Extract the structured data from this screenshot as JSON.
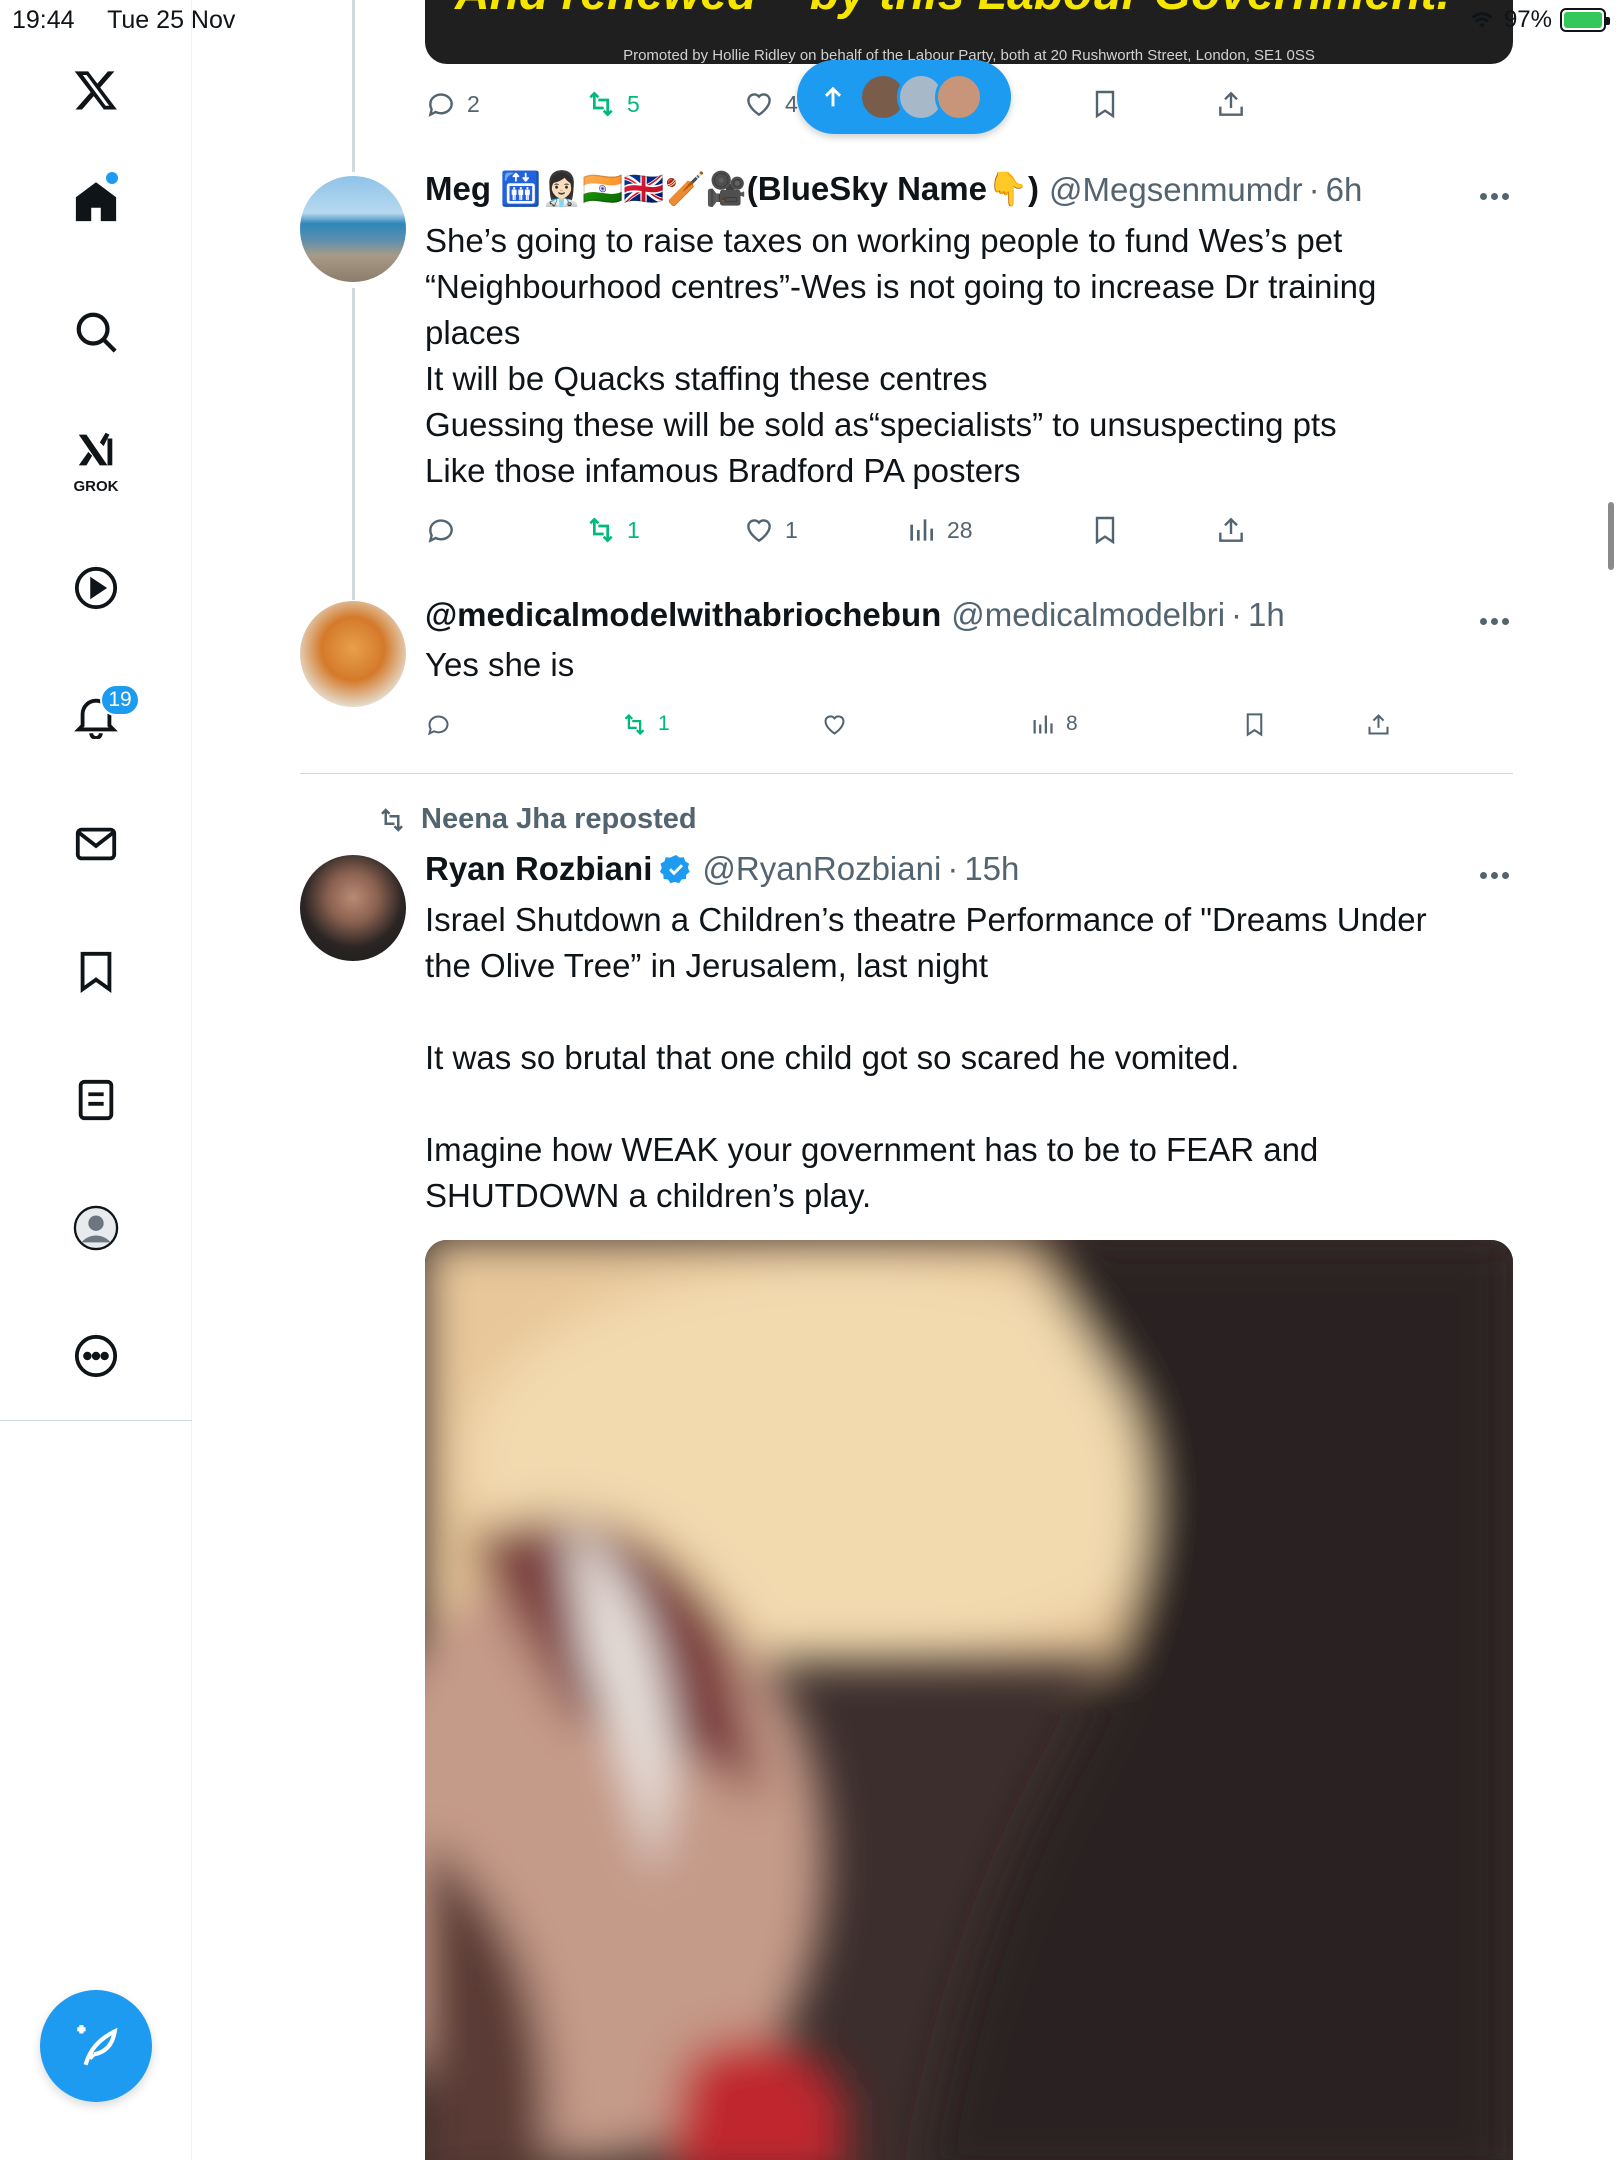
{
  "status_bar": {
    "time": "19:44",
    "date": "Tue 25 Nov",
    "battery": "97%",
    "icons": [
      "wifi-icon",
      "battery-charging-icon"
    ]
  },
  "sidebar": {
    "items": [
      {
        "name": "x-logo",
        "icon": "x-logo-icon"
      },
      {
        "name": "home",
        "icon": "home-icon"
      },
      {
        "name": "explore",
        "icon": "search-icon"
      },
      {
        "name": "grok",
        "icon": "grok-icon",
        "label": "GROK"
      },
      {
        "name": "video",
        "icon": "play-icon"
      },
      {
        "name": "notifications",
        "icon": "bell-icon",
        "badge": "19"
      },
      {
        "name": "messages",
        "icon": "mail-icon"
      },
      {
        "name": "bookmarks",
        "icon": "bookmark-icon"
      },
      {
        "name": "lists",
        "icon": "list-icon"
      },
      {
        "name": "profile",
        "icon": "profile-icon"
      },
      {
        "name": "more",
        "icon": "more-circle-icon"
      }
    ],
    "compose_icon": "compose-feather-icon"
  },
  "ad": {
    "headline": "And renewed – by this Labour Government.",
    "promo": "Promoted by Hollie Ridley on behalf of the Labour Party, both at 20 Rushworth Street, London, SE1 0SS",
    "actions": {
      "replies": "2",
      "reposts": "5",
      "likes": "4"
    }
  },
  "new_posts_pill": {
    "icon": "arrow-up-icon"
  },
  "tweets": [
    {
      "name": "Meg 🛗👩🏻‍⚕️🇮🇳🇬🇧🏏🎥(BlueSky Name👇)",
      "handle": "@Megsenmumdr",
      "time": "6h",
      "lines": [
        "She’s going to raise taxes on working people to fund Wes’s pet",
        "“Neighbourhood centres”-Wes is not going to increase Dr training",
        "places",
        "It will be Quacks staffing these centres",
        "Guessing these will be sold as“specialists” to unsuspecting pts",
        "Like those infamous Bradford PA posters"
      ],
      "actions": {
        "replies": "",
        "reposts": "1",
        "likes": "1",
        "views": "28"
      }
    },
    {
      "name": "@medicalmodelwithabriochebun",
      "handle": "@medicalmodelbri",
      "time": "1h",
      "lines": [
        "Yes she is"
      ],
      "actions": {
        "replies": "",
        "reposts": "1",
        "likes": "",
        "views": "8"
      }
    },
    {
      "reposted_by": "Neena Jha reposted",
      "name": "Ryan Rozbiani",
      "handle": "@RyanRozbiani",
      "time": "15h",
      "verified": true,
      "lines": [
        "Israel Shutdown a Children’s theatre Performance of \"Dreams Under",
        "the Olive Tree” in Jerusalem, last night",
        "",
        "It was so brutal that one child got so scared he vomited.",
        "",
        "Imagine how WEAK your government has to be to FEAR and",
        "SHUTDOWN a children’s play."
      ]
    }
  ],
  "colors": {
    "accent": "#1d9bf0",
    "repost_green": "#00ba7c",
    "muted_text": "#536471",
    "ad_yellow": "#f5e600"
  }
}
